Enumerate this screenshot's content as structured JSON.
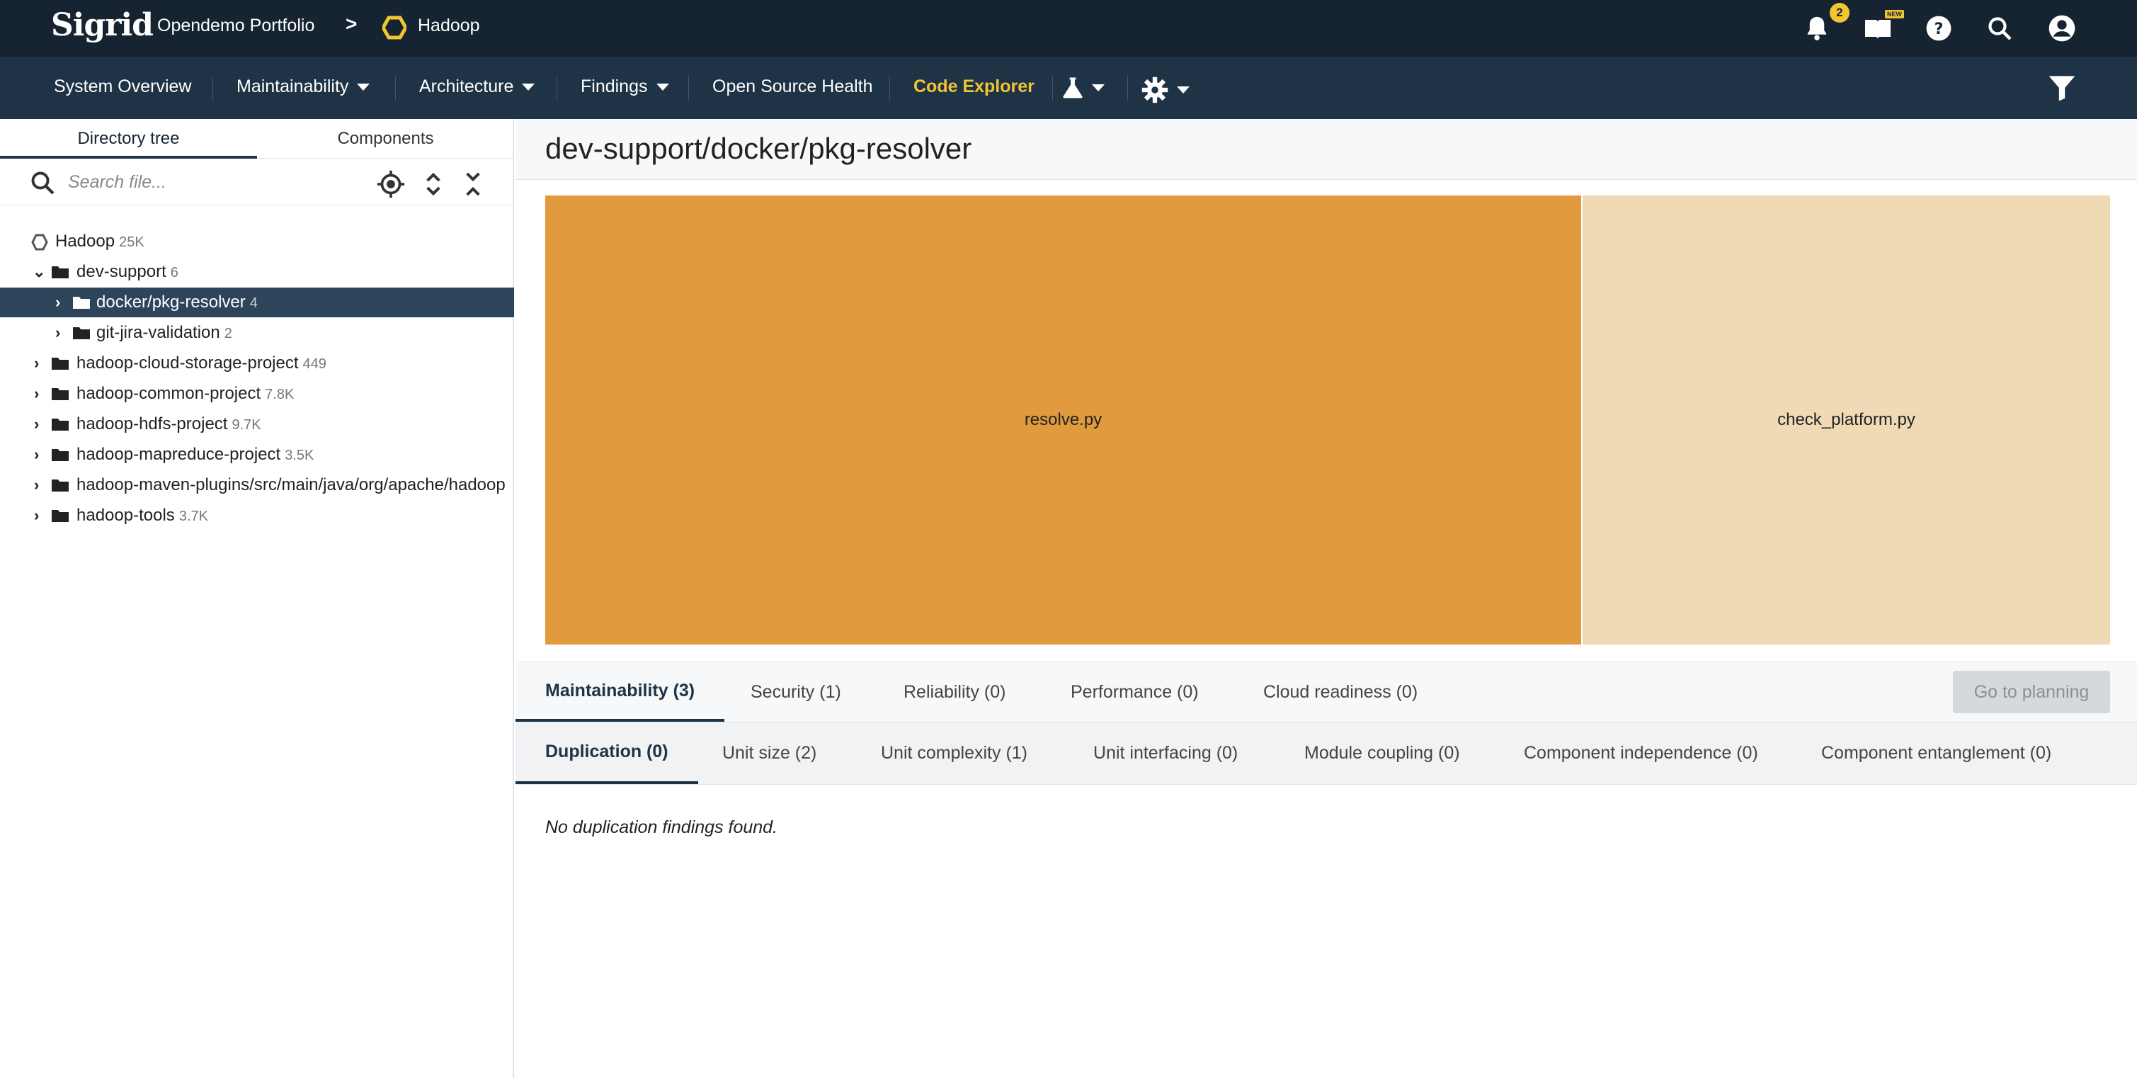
{
  "topbar": {
    "logo": "Sigrid",
    "portfolio": "Opendemo Portfolio",
    "separator": ">",
    "system": "Hadoop",
    "notification_count": "2",
    "new_label": "NEW",
    "icons": [
      "bell-icon",
      "book-icon",
      "help-icon",
      "search-icon",
      "account-icon"
    ]
  },
  "nav": {
    "items": [
      {
        "label": "System Overview",
        "dropdown": false
      },
      {
        "label": "Maintainability",
        "dropdown": true
      },
      {
        "label": "Architecture",
        "dropdown": true
      },
      {
        "label": "Findings",
        "dropdown": true
      },
      {
        "label": "Open Source Health",
        "dropdown": false
      },
      {
        "label": "Code Explorer",
        "dropdown": false,
        "active": true
      }
    ],
    "extra_icons": [
      "flask-icon",
      "gear-icon",
      "filter-icon"
    ]
  },
  "left_panel": {
    "tabs": [
      {
        "label": "Directory tree",
        "active": true
      },
      {
        "label": "Components",
        "active": false
      }
    ],
    "search_placeholder": "Search file...",
    "tree": [
      {
        "label": "Hadoop",
        "count": "25K",
        "depth": 0,
        "icon": "system",
        "chevron": ""
      },
      {
        "label": "dev-support",
        "count": "6",
        "depth": 1,
        "icon": "folder",
        "chevron": "v"
      },
      {
        "label": "docker/pkg-resolver",
        "count": "4",
        "depth": 2,
        "icon": "folder",
        "chevron": ">",
        "selected": true
      },
      {
        "label": "git-jira-validation",
        "count": "2",
        "depth": 2,
        "icon": "folder",
        "chevron": ">"
      },
      {
        "label": "hadoop-cloud-storage-project",
        "count": "449",
        "depth": 1,
        "icon": "folder",
        "chevron": ">"
      },
      {
        "label": "hadoop-common-project",
        "count": "7.8K",
        "depth": 1,
        "icon": "folder",
        "chevron": ">"
      },
      {
        "label": "hadoop-hdfs-project",
        "count": "9.7K",
        "depth": 1,
        "icon": "folder",
        "chevron": ">"
      },
      {
        "label": "hadoop-mapreduce-project",
        "count": "3.5K",
        "depth": 1,
        "icon": "folder",
        "chevron": ">"
      },
      {
        "label": "hadoop-maven-plugins/src/main/java/org/apache/hadoop",
        "count": "",
        "depth": 1,
        "icon": "folder",
        "chevron": ">"
      },
      {
        "label": "hadoop-tools",
        "count": "3.7K",
        "depth": 1,
        "icon": "folder",
        "chevron": ">"
      }
    ]
  },
  "main": {
    "title": "dev-support/docker/pkg-resolver",
    "treemap": [
      {
        "label": "resolve.py",
        "share": 0.662,
        "color": "#e19a3d"
      },
      {
        "label": "check_platform.py",
        "share": 0.338,
        "color": "#f0d9b5"
      }
    ],
    "category_tabs": [
      {
        "label": "Maintainability (3)",
        "active": true
      },
      {
        "label": "Security (1)"
      },
      {
        "label": "Reliability (0)"
      },
      {
        "label": "Performance (0)"
      },
      {
        "label": "Cloud readiness (0)"
      }
    ],
    "plan_button": "Go to planning",
    "property_tabs": [
      {
        "label": "Duplication (0)",
        "active": true
      },
      {
        "label": "Unit size (2)"
      },
      {
        "label": "Unit complexity (1)"
      },
      {
        "label": "Unit interfacing (0)"
      },
      {
        "label": "Module coupling (0)"
      },
      {
        "label": "Component independence (0)"
      },
      {
        "label": "Component entanglement (0)"
      }
    ],
    "empty_message": "No duplication findings found."
  },
  "colors": {
    "topbar": "#162331",
    "navbar": "#1e3346",
    "accent": "#f2c532",
    "selected_row": "#2e445b"
  }
}
